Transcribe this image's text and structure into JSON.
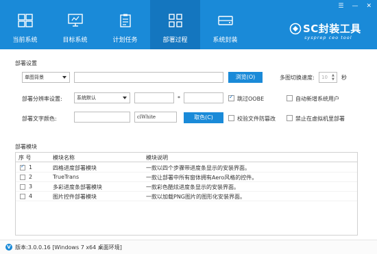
{
  "window": {
    "controls": {
      "menu": "☰",
      "minimize": "—",
      "close": "✕"
    }
  },
  "tabs": [
    {
      "label": "当前系统",
      "icon": "windows-icon",
      "active": false
    },
    {
      "label": "目标系统",
      "icon": "monitor-icon",
      "active": false
    },
    {
      "label": "计划任务",
      "icon": "clipboard-icon",
      "active": false
    },
    {
      "label": "部署过程",
      "icon": "grid-icon",
      "active": true
    },
    {
      "label": "系统封装",
      "icon": "drive-icon",
      "active": false
    }
  ],
  "brand": {
    "title": "SC封装工具",
    "subtitle": "sysprep ceo tool"
  },
  "settings": {
    "section_title": "部署设置",
    "background_select": "单图背景",
    "browse_button": "浏览(O)",
    "switch_speed_label": "多图切换速度:",
    "switch_speed_value": "10",
    "switch_speed_unit": "秒",
    "resolution_label": "部署分辨率设置:",
    "resolution_select": "系统默认",
    "resolution_sep": "*",
    "skip_oobe_label": "跳过OOBE",
    "skip_oobe_checked": true,
    "auto_new_user_label": "自动新增系统用户",
    "auto_new_user_checked": false,
    "text_color_label": "部署文字颜色:",
    "text_color_value": "clWhite",
    "pick_color_button": "取色(C)",
    "verify_files_label": "校验文件防篡改",
    "verify_files_checked": false,
    "no_vm_label": "禁止在虚拟机里部署",
    "no_vm_checked": false
  },
  "modules": {
    "section_title": "部署模块",
    "columns": [
      "序 号",
      "模块名称",
      "模块说明"
    ],
    "rows": [
      {
        "num": "1",
        "checked": true,
        "name": "四格进度部署模块",
        "desc": "一款以四个步骤带进度条显示的安装界面。"
      },
      {
        "num": "2",
        "checked": false,
        "name": "TrueTrans",
        "desc": "一款让部署中所有窗体拥有Aero风格的控件。"
      },
      {
        "num": "3",
        "checked": false,
        "name": "多彩进度条部署模块",
        "desc": "一款彩色酷炫进度条显示的安装界面。"
      },
      {
        "num": "4",
        "checked": false,
        "name": "图片控件部署模块",
        "desc": "一款以加载PNG图片的图形化安装界面。"
      }
    ]
  },
  "status": {
    "version_icon": "V",
    "text": "版本:3.0.0.16 [Windows 7 x64 桌面环境]"
  },
  "colors": {
    "accent": "#1a8ad8",
    "accent_dark": "#1476bf"
  }
}
